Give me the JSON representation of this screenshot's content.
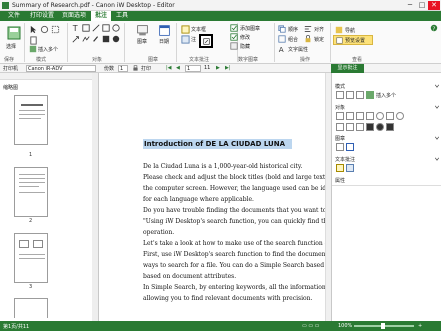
{
  "window": {
    "title": "Summary of Research.pdf - Canon iW Desktop - Editor",
    "minimize": "─",
    "maximize": "□",
    "close": "✕"
  },
  "menu": {
    "tabs": [
      "文件",
      "打印设置",
      "页面选项",
      "批注",
      "工具"
    ],
    "active_index": 3
  },
  "ribbon": {
    "groups": {
      "g1": "保存",
      "g2": "模式",
      "g3": "对象",
      "g4": "图章",
      "g5": "文本批注",
      "g6": "数字图章",
      "g7": "操作",
      "g8": "查看"
    },
    "labels": {
      "edit_mode": "选择",
      "insert_multi": "插入多个",
      "stamp": "图章",
      "date_stamp": "日期",
      "text_note": "文本框",
      "text_shade": "注",
      "show_text": "添加图章",
      "show_shade": "修改",
      "hide": "隐藏",
      "order": "顺序",
      "group": "组合",
      "align": "对齐",
      "lock": "锁定",
      "text_attr": "文字属性",
      "view1": "导航",
      "view2": "预览设置"
    }
  },
  "toolbar2": {
    "printer_label": "打印机",
    "printer_value": "Canon iR-ADV",
    "copies_label": "份数",
    "copies_value": "1",
    "print_label": "打印",
    "page_value": "1",
    "page_total": "11",
    "annot_btn": "显示批注"
  },
  "leftpanel": {
    "title": "缩略图",
    "pages": [
      "1",
      "2",
      "3"
    ]
  },
  "doc": {
    "title": "Introduction of DE LA CIUDAD LUNA",
    "lines": [
      "De la Ciudad Luna is a 1,000-year-old historical city.",
      "Please check and adjust the block titles (bold and large text). Th",
      "the computer screen. However, the language used can be identifi",
      "for each language where applicable.",
      "Do you have trouble finding the documents that you want to refer",
      "\"Using iW Desktop's search function, you can quickly find the",
      "operation.",
      "Let's take a look at how to make use of the search function and cr",
      "First, use iW Desktop's search function to find the documents tha",
      "ways to search for a file. You can do a Simple Search based on S",
      "based on document attributes.",
      "In Simple Search, by entering keywords, all the information conta",
      "allowing you to find relevant documents with precision."
    ]
  },
  "rightpanel": {
    "mode_label": "模式",
    "object_label": "对象",
    "stamp_label": "图章",
    "textnote_label": "文本批注",
    "props_label": "属性",
    "insert_multi": "插入多个",
    "select": "选择"
  },
  "status": {
    "page_info": "第1页/共11",
    "zoom": "100%"
  },
  "colors": {
    "accent": "#2a7a33",
    "title_highlight": "#bcd6ef"
  }
}
